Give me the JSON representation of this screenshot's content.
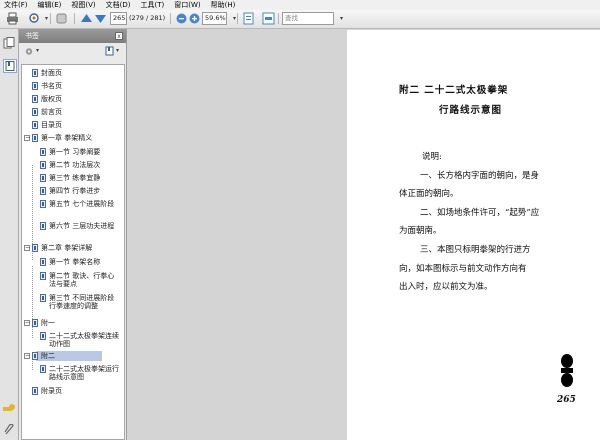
{
  "menu": [
    "文件(F)",
    "编辑(E)",
    "视图(V)",
    "文档(D)",
    "工具(T)",
    "窗口(W)",
    "帮助(H)"
  ],
  "toolbar": {
    "page_number": "265",
    "page_total": "(279 / 281)",
    "zoom": "59.6%",
    "search_placeholder": "查找"
  },
  "panel": {
    "title": "书签",
    "close": "x"
  },
  "bookmarks": [
    "封面页",
    "书名页",
    "版权页",
    "前言页",
    "目录页",
    "第一章  拳架精义",
    "第一节  习拳阐要",
    "第二节  功法层次",
    "第三节  练拳宜静",
    "第四节  行拳进步",
    "第五节  七个进展阶段",
    "第六节  三层功夫进程",
    "第二章  拳架详解",
    "第一节  拳架名称",
    "第二节  歌诀、行拳心法与要点",
    "第三节  不同进展阶段行拳速度的调整",
    "附一",
    "二十二式太极拳架连续动作图",
    "附二",
    "二十二式太极拳架运行路线示意图",
    "附录页"
  ],
  "page": {
    "title_line1": "附二   二十二式太极拳架",
    "title_line2": "行路线示意图",
    "heading": "说明:",
    "lines": [
      "一、长方格内字面的朝向，是身",
      "体正面的朝向。",
      "二、如场地条件许可，“起势”应",
      "为面朝南。",
      "三、本图只标明拳架的行进方",
      "向，如本图标示与前文动作方向有",
      "出入时，应以前文为准。"
    ],
    "page_number": "265"
  }
}
